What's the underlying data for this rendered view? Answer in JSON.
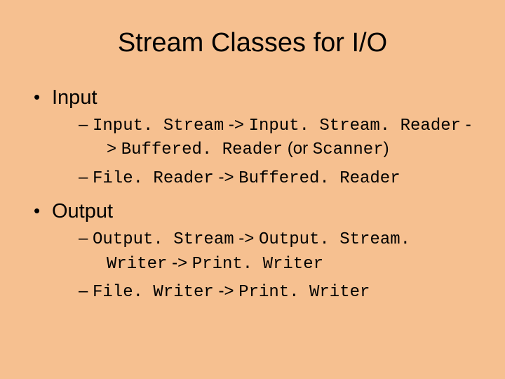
{
  "title": "Stream Classes for I/O",
  "input": {
    "heading": "Input",
    "item1": {
      "c1": "Input. Stream",
      "t1": " -> ",
      "c2": "Input. Stream. Reader",
      "t2": " -> ",
      "c3": "Buffered. Reader",
      "t3": " (or ",
      "c4": "Scanner",
      "t4": ")"
    },
    "item2": {
      "c1": "File. Reader",
      "t1": " -> ",
      "c2": "Buffered. Reader"
    }
  },
  "output": {
    "heading": "Output",
    "item1": {
      "c1": "Output. Stream",
      "t1": " -> ",
      "c2": "Output. Stream. Writer",
      "t2": " -> ",
      "c3": "Print. Writer"
    },
    "item2": {
      "c1": "File. Writer",
      "t1": " -> ",
      "c2": "Print. Writer"
    }
  }
}
